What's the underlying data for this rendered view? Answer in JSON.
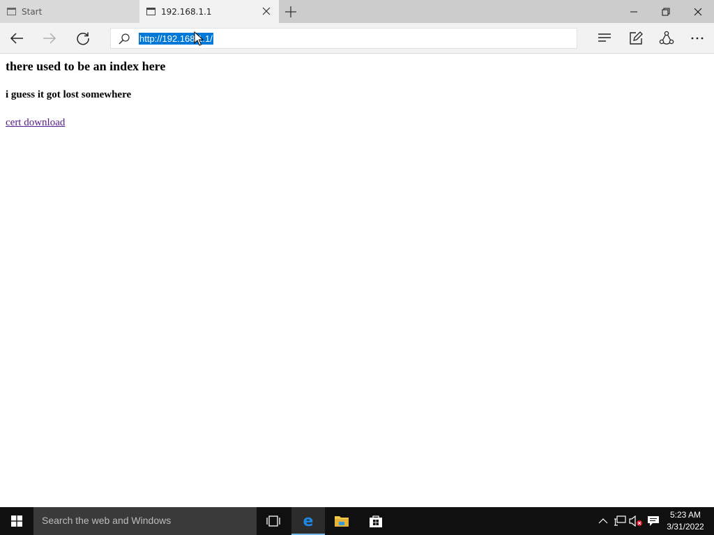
{
  "tabs": [
    {
      "title": "Start",
      "active": false
    },
    {
      "title": "192.168.1.1",
      "active": true
    }
  ],
  "navbar": {
    "url": "http://192.168.1.1/"
  },
  "page": {
    "heading": "there used to be an index here",
    "subheading": "i guess it got lost somewhere",
    "link_text": "cert download"
  },
  "taskbar": {
    "search_placeholder": "Search the web and Windows",
    "time": "5:23 AM",
    "date": "3/31/2022"
  },
  "colors": {
    "selection": "#0078d7",
    "visited_link": "#551a8b",
    "taskbar": "#101010",
    "edge_blue": "#1e88e5"
  },
  "icons": [
    "page-icon",
    "close-icon",
    "plus-icon",
    "minimize-icon",
    "restore-icon",
    "back-arrow-icon",
    "forward-arrow-icon",
    "refresh-icon",
    "search-icon",
    "hub-icon",
    "web-note-icon",
    "share-icon",
    "more-icon",
    "windows-logo-icon",
    "task-view-icon",
    "edge-icon",
    "file-explorer-icon",
    "store-icon",
    "chevron-up-icon",
    "network-icon",
    "volume-muted-icon",
    "action-center-icon"
  ]
}
